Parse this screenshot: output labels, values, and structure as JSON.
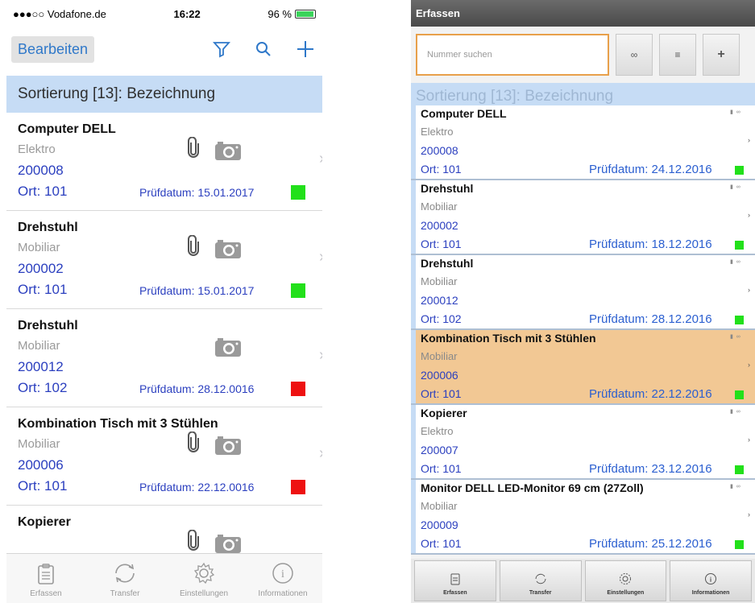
{
  "ios": {
    "status": {
      "carrier": "●●●○○ Vodafone.de",
      "time": "16:22",
      "battery": "96 %",
      "battery_level": 0.96
    },
    "nav": {
      "edit_label": "Bearbeiten"
    },
    "sort_label": "Sortierung [13]: Bezeichnung",
    "items": [
      {
        "name": "Computer DELL",
        "category": "Elektro",
        "number": "200008",
        "ort": "Ort: 101",
        "pruef": "Prüfdatum: 15.01.2017",
        "status_color": "#22e01a",
        "clip": true,
        "cam": true
      },
      {
        "name": "Drehstuhl",
        "category": "Mobiliar",
        "number": "200002",
        "ort": "Ort: 101",
        "pruef": "Prüfdatum: 15.01.2017",
        "status_color": "#22e01a",
        "clip": true,
        "cam": true
      },
      {
        "name": "Drehstuhl",
        "category": "Mobiliar",
        "number": "200012",
        "ort": "Ort: 102",
        "pruef": "Prüfdatum: 28.12.0016",
        "status_color": "#ee1111",
        "clip": false,
        "cam": true
      },
      {
        "name": "Kombination Tisch mit 3 Stühlen",
        "category": "Mobiliar",
        "number": "200006",
        "ort": "Ort: 101",
        "pruef": "Prüfdatum: 22.12.0016",
        "status_color": "#ee1111",
        "clip": true,
        "cam": true
      },
      {
        "name": "Kopierer",
        "category": "",
        "number": "",
        "ort": "",
        "pruef": "",
        "status_color": "",
        "clip": true,
        "cam": true
      }
    ],
    "tabs": [
      {
        "label": "Erfassen",
        "active": true
      },
      {
        "label": "Transfer",
        "active": false
      },
      {
        "label": "Einstellungen",
        "active": false
      },
      {
        "label": "Informationen",
        "active": false
      }
    ]
  },
  "android": {
    "title": "Erfassen",
    "search_placeholder": "Nummer suchen",
    "sort_label": "Sortierung [13]: Bezeichnung",
    "items": [
      {
        "name": "Computer DELL",
        "category": "Elektro",
        "number": "200008",
        "ort": "Ort: 101",
        "pruef": "Prüfdatum: 24.12.2016",
        "highlight": false
      },
      {
        "name": "Drehstuhl",
        "category": "Mobiliar",
        "number": "200002",
        "ort": "Ort: 101",
        "pruef": "Prüfdatum: 18.12.2016",
        "highlight": false
      },
      {
        "name": "Drehstuhl",
        "category": "Mobiliar",
        "number": "200012",
        "ort": "Ort: 102",
        "pruef": "Prüfdatum: 28.12.2016",
        "highlight": false
      },
      {
        "name": "Kombination Tisch mit 3 Stühlen",
        "category": "Mobiliar",
        "number": "200006",
        "ort": "Ort: 101",
        "pruef": "Prüfdatum: 22.12.2016",
        "highlight": true
      },
      {
        "name": "Kopierer",
        "category": "Elektro",
        "number": "200007",
        "ort": "Ort: 101",
        "pruef": "Prüfdatum: 23.12.2016",
        "highlight": false
      },
      {
        "name": "Monitor DELL LED-Monitor 69 cm (27Zoll)",
        "category": "Mobiliar",
        "number": "200009",
        "ort": "Ort: 101",
        "pruef": "Prüfdatum: 25.12.2016",
        "highlight": false
      }
    ],
    "status_color": "#22e01a",
    "tabs": [
      "Erfassen",
      "Transfer",
      "Einstellungen",
      "Informationen"
    ]
  },
  "colors": {
    "ios_blue": "#2f78c9",
    "sort_bar": "#c6dcf5",
    "link_blue": "#2b3fbf",
    "highlight": "#f2c894",
    "search_border": "#e8a04a"
  }
}
